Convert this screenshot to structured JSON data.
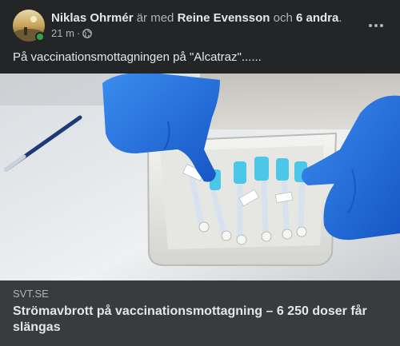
{
  "post": {
    "author": "Niklas Ohrmér",
    "with_text": " är med ",
    "tagged": "Reine Evensson",
    "and_text": " och ",
    "others": "6 andra",
    "period": ".",
    "time": "21 m",
    "separator": "·",
    "privacy_icon": "globe-icon",
    "message": "På vaccinationsmottagningen på \"Alcatraz\"......"
  },
  "link": {
    "domain": "SVT.SE",
    "title": "Strömavbrott på vaccinationsmottagning – 6 250 doser får slängas"
  },
  "colors": {
    "background": "#242526",
    "link_box": "#3a3b3c",
    "primary_text": "#e4e6eb",
    "secondary_text": "#b0b3b8",
    "online": "#31a24c",
    "glove": "#1f6fd8"
  }
}
